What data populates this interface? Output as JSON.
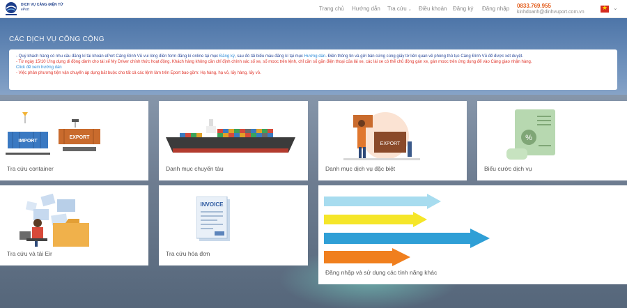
{
  "brand": {
    "title": "DỊCH VỤ CẢNG ĐIỆN TỬ",
    "subtitle": "ePort"
  },
  "nav": {
    "items": [
      "Trang chủ",
      "Hướng dẫn",
      "Tra cứu",
      "Điều khoản",
      "Đăng ký",
      "Đăng nhập"
    ]
  },
  "contact": {
    "phone": "0833.769.955",
    "email": "kinhdoanh@dinhvuport.com.vn"
  },
  "section_title": "CÁC DỊCH VỤ CÔNG CỘNG",
  "notice": {
    "line1_a": "- Quý khách hàng có nhu cầu đăng kí tài khoản ePort Cảng Đình Vũ vui lòng điền form đăng kí online tại mục ",
    "line1_link1": "Đăng ký",
    "line1_b": ", sau đó tải biểu mẫu đăng kí tại mục ",
    "line1_link2": "Hướng dẫn",
    "line1_c": ". Điền thông tin và gửi bản cứng cùng giấy tờ liên quan về phòng thủ tục Cảng Đình Vũ để được xét duyệt.",
    "line2": "- Từ ngày 15/10 Ứng dụng di động dành cho tài xế My Driver chính thức hoạt động. Khách hàng không cần chỉ định chính xác số xe, số mooc trên lệnh, chỉ cần số gắn điện thoại của lái xe, các lái xe có thể chủ động gán xe, gán mooc trên ứng dụng để vào Cảng giao nhận hàng.",
    "line3": "Click để xem hướng dẫn",
    "line4": "- Việc phân phương tiện vận chuyển áp dụng bắt buộc cho tất cả các lệnh làm trên Eport bao gồm: Hạ hàng, hạ vỏ, lấy hàng, lấy vỏ."
  },
  "cards": [
    {
      "label": "Tra cứu container",
      "icon": "container-icon",
      "img_text_import": "IMPORT",
      "img_text_export": "EXPORT"
    },
    {
      "label": "Danh mục chuyến tàu",
      "icon": "ship-icon"
    },
    {
      "label": "Danh mục dịch vụ đặc biệt",
      "icon": "special-service-icon",
      "img_text": "EXPORT"
    },
    {
      "label": "Biểu cước dịch vụ",
      "icon": "tariff-icon"
    },
    {
      "label": "Tra cứu và tải Eir",
      "icon": "eir-icon"
    },
    {
      "label": "Tra cứu hóa đơn",
      "icon": "invoice-icon",
      "img_text": "INVOICE"
    },
    {
      "label": "Đăng nhập và sử dụng các tính năng khác",
      "icon": "arrows-icon"
    }
  ],
  "colors": {
    "brand_blue": "#1d3e8a",
    "accent_orange": "#e35d1c",
    "notice_red": "#e0352b",
    "link_blue": "#2a8ad8"
  }
}
